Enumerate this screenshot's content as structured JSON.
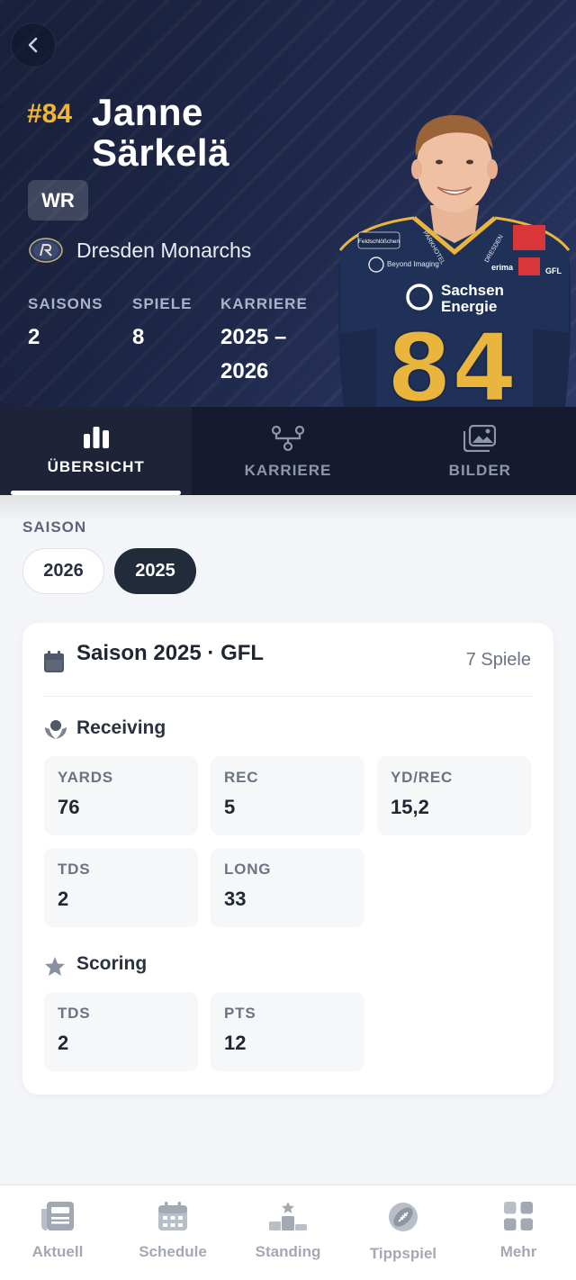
{
  "player": {
    "number": "#84",
    "first_name": "Janne",
    "last_name": "Särkelä",
    "position": "WR",
    "team": "Dresden Monarchs",
    "stats": [
      {
        "label": "SAISONS",
        "value": "2"
      },
      {
        "label": "SPIELE",
        "value": "8"
      },
      {
        "label": "KARRIERE",
        "value_line1": "2025 –",
        "value_line2": "2026"
      }
    ],
    "jersey_sponsors": [
      "Feldschlößchen",
      "PARKHOTEL",
      "DRESDEN",
      "Beyond Imaging",
      "erima",
      "Sachsen",
      "Energie",
      "GFL"
    ],
    "jersey_number": "84"
  },
  "tabs": [
    {
      "label": "ÜBERSICHT",
      "icon": "bar-chart-icon",
      "active": true
    },
    {
      "label": "KARRIERE",
      "icon": "timeline-icon",
      "active": false
    },
    {
      "label": "BILDER",
      "icon": "gallery-icon",
      "active": false
    }
  ],
  "season_selector": {
    "label": "SAISON",
    "options": [
      "2026",
      "2025"
    ],
    "selected": "2025"
  },
  "season_card": {
    "title": "Saison 2025 · GFL",
    "games": "7 Spiele",
    "sections": [
      {
        "title": "Receiving",
        "icon": "receiving-hands-icon",
        "stats": [
          {
            "label": "YARDS",
            "value": "76"
          },
          {
            "label": "REC",
            "value": "5"
          },
          {
            "label": "YD/REC",
            "value": "15,2"
          },
          {
            "label": "TDS",
            "value": "2"
          },
          {
            "label": "LONG",
            "value": "33"
          }
        ]
      },
      {
        "title": "Scoring",
        "icon": "star-icon",
        "stats": [
          {
            "label": "TDS",
            "value": "2"
          },
          {
            "label": "PTS",
            "value": "12"
          }
        ]
      }
    ]
  },
  "bottom_nav": [
    {
      "label": "Aktuell",
      "icon": "newspaper-icon"
    },
    {
      "label": "Schedule",
      "icon": "calendar-icon"
    },
    {
      "label": "Standing",
      "icon": "podium-icon"
    },
    {
      "label": "Tippspiel",
      "icon": "football-icon"
    },
    {
      "label": "Mehr",
      "icon": "grid-icon"
    }
  ],
  "colors": {
    "hero_bg": "#202a4d",
    "number_accent": "#f2b632",
    "tab_bar": "#161a30",
    "chip_active": "#222b3a",
    "jersey_navy": "#1b2a4a",
    "jersey_gold": "#e9b53c"
  }
}
